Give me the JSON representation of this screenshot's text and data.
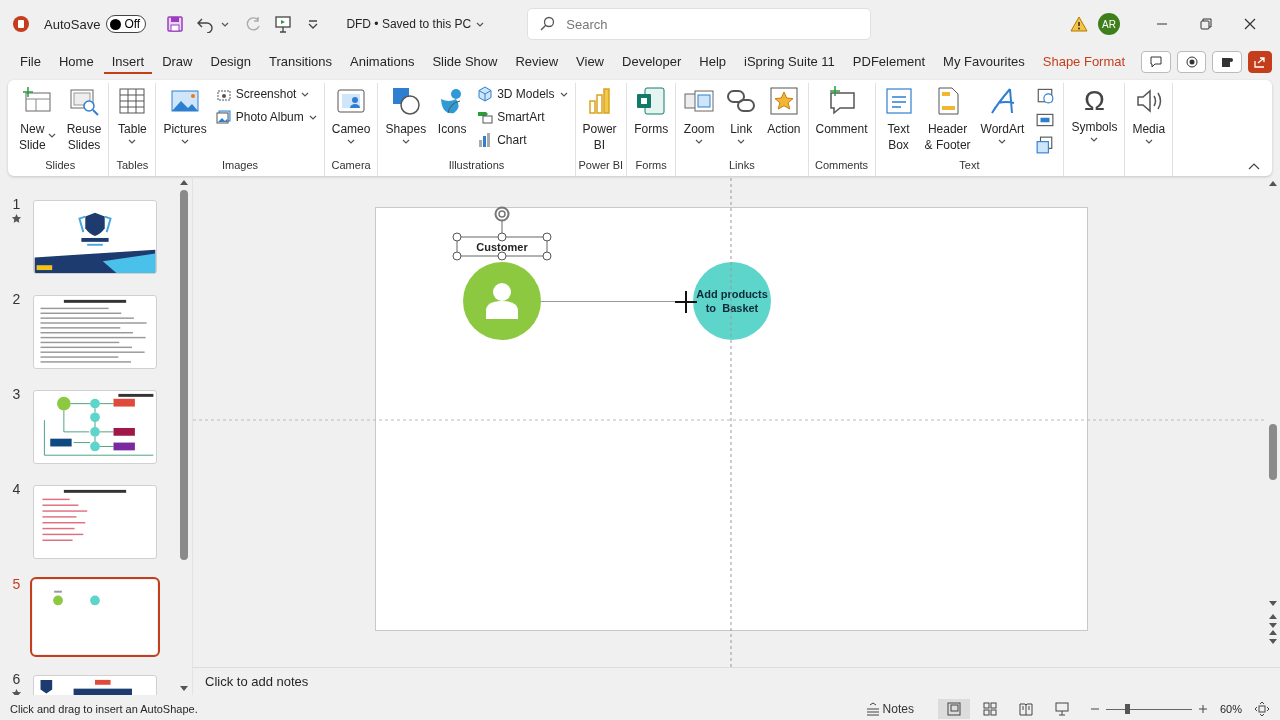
{
  "title_bar": {
    "autosave_label": "AutoSave",
    "autosave": {
      "on": false,
      "label": "Off"
    },
    "document": "DFD • Saved to this PC",
    "search": {
      "placeholder": "Search"
    },
    "user_initials": "AR"
  },
  "menu_tabs": [
    {
      "label": "File",
      "selected": false,
      "kind": "normal"
    },
    {
      "label": "Home",
      "selected": false,
      "kind": "normal"
    },
    {
      "label": "Insert",
      "selected": true,
      "kind": "normal"
    },
    {
      "label": "Draw",
      "selected": false,
      "kind": "normal"
    },
    {
      "label": "Design",
      "selected": false,
      "kind": "normal"
    },
    {
      "label": "Transitions",
      "selected": false,
      "kind": "normal"
    },
    {
      "label": "Animations",
      "selected": false,
      "kind": "normal"
    },
    {
      "label": "Slide Show",
      "selected": false,
      "kind": "normal"
    },
    {
      "label": "Review",
      "selected": false,
      "kind": "normal"
    },
    {
      "label": "View",
      "selected": false,
      "kind": "normal"
    },
    {
      "label": "Developer",
      "selected": false,
      "kind": "normal"
    },
    {
      "label": "Help",
      "selected": false,
      "kind": "normal"
    },
    {
      "label": "iSpring Suite 11",
      "selected": false,
      "kind": "normal"
    },
    {
      "label": "PDFelement",
      "selected": false,
      "kind": "normal"
    },
    {
      "label": "My Favourites",
      "selected": false,
      "kind": "normal"
    },
    {
      "label": "Shape Format",
      "selected": false,
      "kind": "contextual"
    }
  ],
  "ribbon": {
    "groups": [
      {
        "label": "Slides",
        "items": [
          {
            "kind": "large-inline",
            "label": "New\nSlide",
            "dropdown": true
          },
          {
            "kind": "large",
            "label": "Reuse\nSlides",
            "dropdown": false
          }
        ]
      },
      {
        "label": "Tables",
        "items": [
          {
            "kind": "large",
            "label": "Table",
            "dropdown": true
          }
        ]
      },
      {
        "label": "Images",
        "items": [
          {
            "kind": "large",
            "label": "Pictures",
            "dropdown": true
          },
          {
            "kind": "stack",
            "items": [
              {
                "kind": "small",
                "label": "Screenshot",
                "dropdown": true
              },
              {
                "kind": "small",
                "label": "Photo Album",
                "dropdown": true
              }
            ]
          }
        ]
      },
      {
        "label": "Camera",
        "items": [
          {
            "kind": "large",
            "label": "Cameo",
            "dropdown": true
          }
        ]
      },
      {
        "label": "Illustrations",
        "items": [
          {
            "kind": "large",
            "label": "Shapes",
            "dropdown": true
          },
          {
            "kind": "large",
            "label": "Icons",
            "dropdown": false
          },
          {
            "kind": "stack",
            "items": [
              {
                "kind": "small",
                "label": "3D Models",
                "dropdown": true
              },
              {
                "kind": "small",
                "label": "SmartArt",
                "dropdown": false
              },
              {
                "kind": "small",
                "label": "Chart",
                "dropdown": false
              }
            ]
          }
        ]
      },
      {
        "label": "Power BI",
        "items": [
          {
            "kind": "large",
            "label": "Power\nBI",
            "dropdown": false
          }
        ]
      },
      {
        "label": "Forms",
        "items": [
          {
            "kind": "large",
            "label": "Forms",
            "dropdown": false
          }
        ]
      },
      {
        "label": "Links",
        "items": [
          {
            "kind": "large",
            "label": "Zoom",
            "dropdown": true
          },
          {
            "kind": "large",
            "label": "Link",
            "dropdown": true
          },
          {
            "kind": "large",
            "label": "Action",
            "dropdown": false
          }
        ]
      },
      {
        "label": "Comments",
        "items": [
          {
            "kind": "large",
            "label": "Comment",
            "dropdown": false
          }
        ]
      },
      {
        "label": "Text",
        "items": [
          {
            "kind": "large",
            "label": "Text\nBox",
            "dropdown": false
          },
          {
            "kind": "large",
            "label": "Header\n& Footer",
            "dropdown": false
          },
          {
            "kind": "large",
            "label": "WordArt",
            "dropdown": true
          },
          {
            "kind": "stack",
            "items": [
              {
                "kind": "icon"
              },
              {
                "kind": "icon"
              },
              {
                "kind": "icon"
              }
            ]
          }
        ]
      },
      {
        "items": [
          {
            "kind": "large",
            "label": "Symbols",
            "glyph": "Ω",
            "dropdown": true
          }
        ]
      },
      {
        "items": [
          {
            "kind": "large",
            "label": "Media",
            "dropdown": true
          }
        ]
      }
    ]
  },
  "slides": [
    {
      "number": "1",
      "starred": true,
      "selected": false,
      "kind": "title"
    },
    {
      "number": "2",
      "starred": false,
      "selected": false,
      "kind": "list"
    },
    {
      "number": "3",
      "starred": false,
      "selected": false,
      "kind": "workflow"
    },
    {
      "number": "4",
      "starred": false,
      "selected": false,
      "kind": "red-list"
    },
    {
      "number": "5",
      "starred": false,
      "selected": true,
      "kind": "diagram"
    },
    {
      "number": "6",
      "starred": true,
      "selected": false,
      "kind": "poster"
    }
  ],
  "slide": {
    "nodes": [
      {
        "kind": "actor",
        "label": "Customer",
        "color": "#8cc940",
        "selected": true
      },
      {
        "kind": "process",
        "label": "Add products\nto  Basket",
        "color": "#5dd5ca",
        "selected": false
      }
    ]
  },
  "notes": {
    "placeholder": "Click to add notes"
  },
  "status_bar": {
    "message": "Click and drag to insert an AutoShape.",
    "notes_label": "Notes",
    "views": [
      {
        "selected": true
      },
      {
        "selected": false
      },
      {
        "selected": false
      },
      {
        "selected": false
      }
    ],
    "zoom": {
      "level": 0.25,
      "reading": "60%"
    }
  }
}
